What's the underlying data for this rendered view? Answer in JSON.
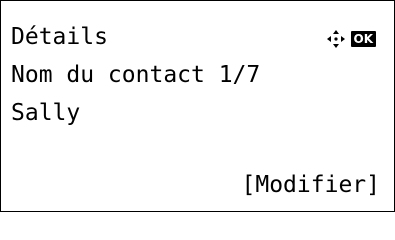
{
  "screen": {
    "title": "Détails",
    "field_label": "Nom du contact 1/7",
    "field_value": "Sally",
    "action_label": "[Modifier]"
  },
  "status": {
    "nav_icon": "four-way-arrow-icon",
    "ok_label": "OK"
  }
}
